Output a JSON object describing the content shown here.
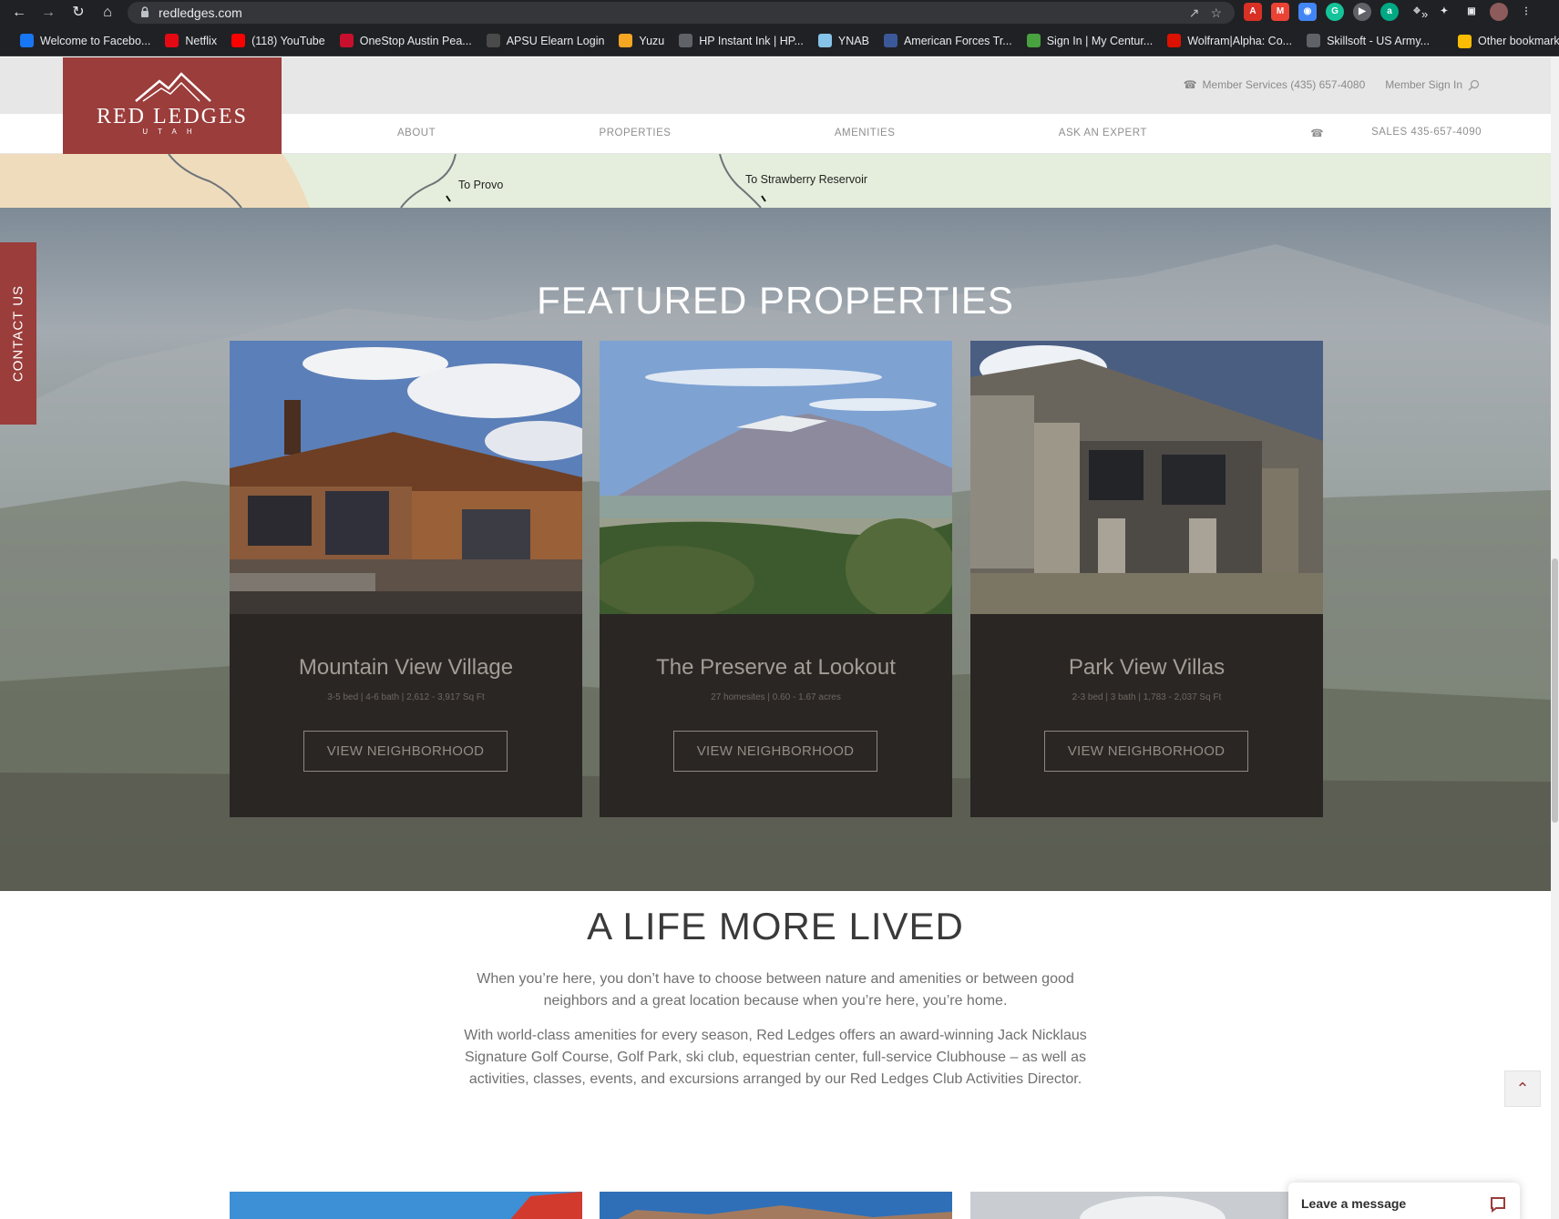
{
  "browser": {
    "url": "redledges.com",
    "bookmarks": [
      {
        "label": "Welcome to Facebo...",
        "icon": "facebook-icon",
        "color": "#1877f2"
      },
      {
        "label": "Netflix",
        "icon": "netflix-icon",
        "color": "#e50914"
      },
      {
        "label": "(118) YouTube",
        "icon": "youtube-icon",
        "color": "#ff0000"
      },
      {
        "label": "OneStop Austin Pea...",
        "icon": "onestop-icon",
        "color": "#c8102e"
      },
      {
        "label": "APSU Elearn Login",
        "icon": "d2l-icon",
        "color": "#4a4a4a"
      },
      {
        "label": "Yuzu",
        "icon": "yuzu-icon",
        "color": "#f5a623"
      },
      {
        "label": "HP Instant Ink | HP...",
        "icon": "globe-icon",
        "color": "#5f6368"
      },
      {
        "label": "YNAB",
        "icon": "ynab-icon",
        "color": "#85c3e9"
      },
      {
        "label": "American Forces Tr...",
        "icon": "aft-icon",
        "color": "#3b5998"
      },
      {
        "label": "Sign In | My Centur...",
        "icon": "century-icon",
        "color": "#48a23f"
      },
      {
        "label": "Wolfram|Alpha: Co...",
        "icon": "wolfram-icon",
        "color": "#dd1100"
      },
      {
        "label": "Skillsoft - US Army...",
        "icon": "globe-icon",
        "color": "#5f6368"
      }
    ],
    "more_label": "»",
    "other_bookmarks": "Other bookmarks"
  },
  "header": {
    "member_services": "Member Services (435) 657-4080",
    "member_sign_in": "Member Sign In",
    "logo_name": "RED LEDGES",
    "logo_sub": "UTAH",
    "nav": [
      "ABOUT",
      "PROPERTIES",
      "AMENITIES",
      "ASK AN EXPERT"
    ],
    "sales": "SALES 435-657-4090"
  },
  "map": {
    "label_provo": "To Provo",
    "label_strawberry": "To Strawberry Reservoir"
  },
  "featured": {
    "title": "FEATURED PROPERTIES",
    "cards": [
      {
        "title": "Mountain View Village",
        "details": "3-5 bed | 4-6 bath | 2,612 - 3,917 Sq Ft",
        "button": "VIEW NEIGHBORHOOD"
      },
      {
        "title": "The Preserve at Lookout",
        "details": "27 homesites | 0.60 - 1.67 acres",
        "button": "VIEW NEIGHBORHOOD"
      },
      {
        "title": "Park View Villas",
        "details": "2-3 bed | 3 bath | 1,783 - 2,037 Sq Ft",
        "button": "VIEW NEIGHBORHOOD"
      }
    ]
  },
  "contact_tab": "CONTACT US",
  "life": {
    "title": "A LIFE MORE LIVED",
    "p1_line1": "When you’re here, you don’t have to choose between nature and amenities or between good",
    "p1_line2": "neighbors and a great location because when you’re here, you’re home.",
    "p2_line1": "With world-class amenities for every season, Red Ledges offers an award-winning Jack Nicklaus",
    "p2_line2": "Signature Golf Course, Golf Park, ski club, equestrian center, full-service Clubhouse – as well as",
    "p2_line3": "activities, classes, events, and excursions arranged by our Red Ledges Club Activities Director."
  },
  "chat": {
    "label": "Leave a message"
  },
  "colors": {
    "brand": "#9a3d3b",
    "card_bg": "#2a2623"
  }
}
